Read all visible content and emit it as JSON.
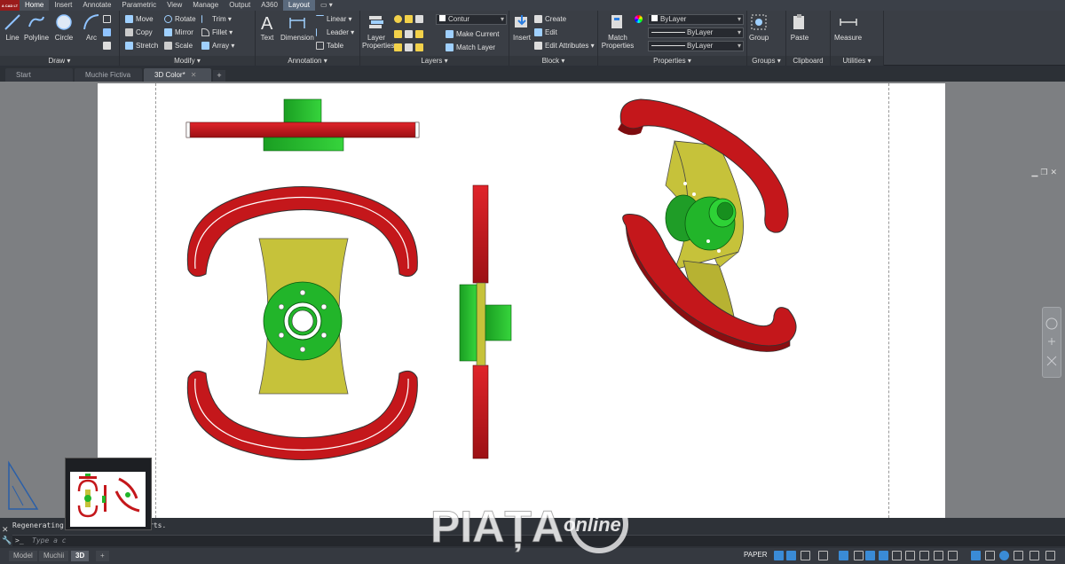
{
  "app": {
    "logo_text": "A CAD LT"
  },
  "ribbon_tabs": [
    "Home",
    "Insert",
    "Annotate",
    "Parametric",
    "View",
    "Manage",
    "Output",
    "A360",
    "Layout"
  ],
  "draw_panel": {
    "title": "Draw",
    "tools": [
      "Line",
      "Polyline",
      "Circle",
      "Arc"
    ]
  },
  "modify_panel": {
    "title": "Modify",
    "tools": [
      "Move",
      "Rotate",
      "Trim",
      "Copy",
      "Mirror",
      "Fillet",
      "Stretch",
      "Scale",
      "Array"
    ]
  },
  "annotation_panel": {
    "title": "Annotation",
    "text": "Text",
    "dimension": "Dimension",
    "linear": "Linear",
    "leader": "Leader",
    "table": "Table"
  },
  "layers_panel": {
    "title": "Layers",
    "layer_properties": "Layer\nProperties",
    "layer_combo": "Contur",
    "make_current": "Make Current",
    "match_layer": "Match Layer"
  },
  "block_panel": {
    "title": "Block",
    "insert": "Insert",
    "create": "Create",
    "edit": "Edit",
    "edit_attributes": "Edit Attributes"
  },
  "properties_panel": {
    "title": "Properties",
    "match": "Match\nProperties",
    "color": "ByLayer",
    "linetype": "ByLayer",
    "lineweight": "ByLayer"
  },
  "groups_panel": {
    "title": "Groups",
    "group": "Group"
  },
  "clipboard_panel": {
    "title": "Clipboard",
    "paste": "Paste"
  },
  "utilities_panel": {
    "title": "Utilities",
    "measure": "Measure"
  },
  "file_tabs": [
    {
      "label": "Start",
      "active": false
    },
    {
      "label": "Muchie Fictiva",
      "active": false
    },
    {
      "label": "3D Color*",
      "active": true
    }
  ],
  "command": {
    "history_left": "Regenerating",
    "history_right": "rts.",
    "placeholder": "Type a c"
  },
  "layout_tabs": [
    "Model",
    "Muchii",
    "3D"
  ],
  "status": {
    "space": "PAPER"
  },
  "watermark": {
    "text": "PIAȚA",
    "sub": "online"
  },
  "colors": {
    "rim": "#c4171b",
    "spoke": "#c6c23a",
    "hub": "#22b52a"
  }
}
